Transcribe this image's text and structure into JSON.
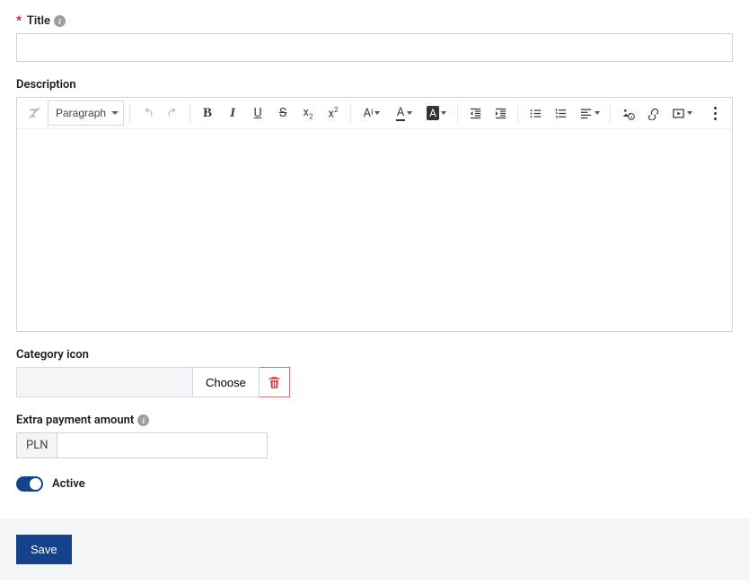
{
  "labels": {
    "title": "Title",
    "description": "Description",
    "category_icon": "Category icon",
    "extra_payment": "Extra payment amount",
    "active": "Active",
    "required_mark": "*"
  },
  "editor": {
    "format": "Paragraph"
  },
  "buttons": {
    "choose": "Choose",
    "save": "Save"
  },
  "currency": "PLN",
  "values": {
    "title": "",
    "amount": "",
    "active": true
  }
}
